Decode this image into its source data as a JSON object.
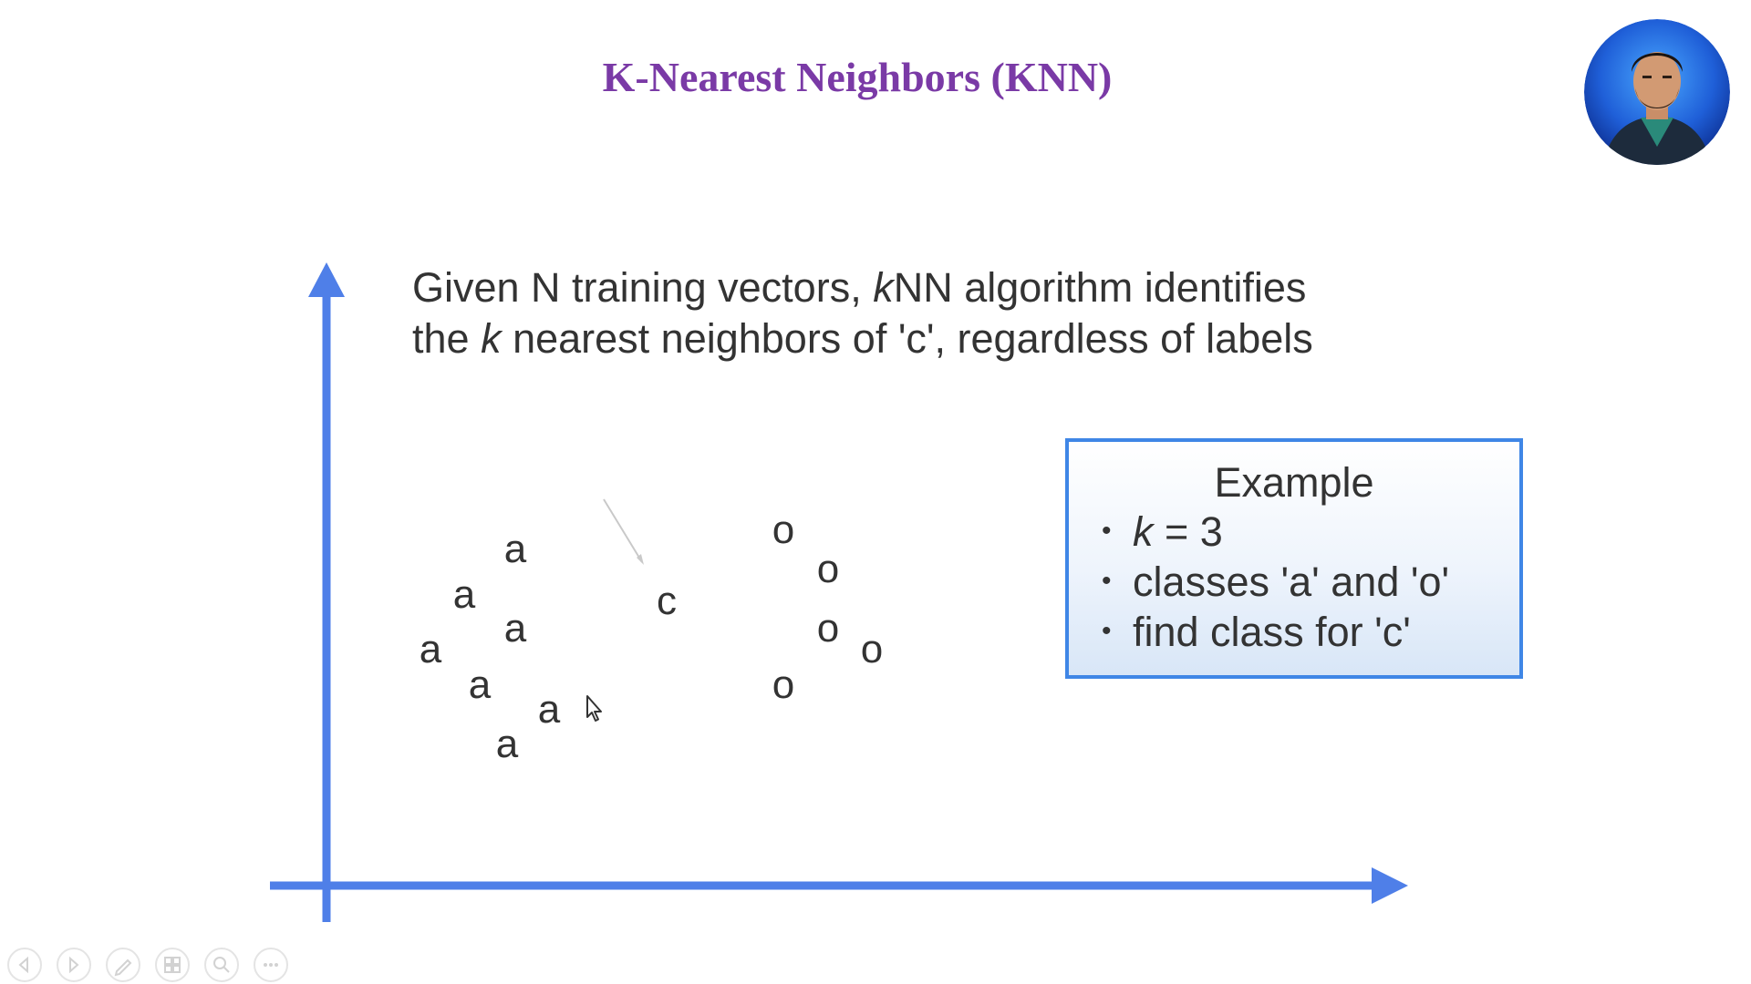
{
  "slide": {
    "title": "K-Nearest Neighbors (KNN)",
    "description": {
      "line1_pre": "Given N training vectors, ",
      "line1_k": "k",
      "line1_post": "NN algorithm identifies",
      "line2_pre": "the ",
      "line2_k": "k",
      "line2_post": " nearest neighbors of 'c', regardless of labels"
    },
    "points": {
      "class_a_label": "a",
      "class_o_label": "o",
      "query_label": "c"
    },
    "example": {
      "title": "Example",
      "bullet": "•",
      "item1_k": "k",
      "item1_rest": " = 3",
      "item2": "classes 'a' and 'o'",
      "item3": "find class for 'c'"
    }
  },
  "colors": {
    "title": "#7a3aa6",
    "axis": "#4f7fe8",
    "text": "#333333",
    "box_border": "#3f86e6"
  },
  "controls": [
    "previous-slide-icon",
    "next-slide-icon",
    "pen-icon",
    "slides-grid-icon",
    "zoom-icon",
    "more-options-icon"
  ]
}
